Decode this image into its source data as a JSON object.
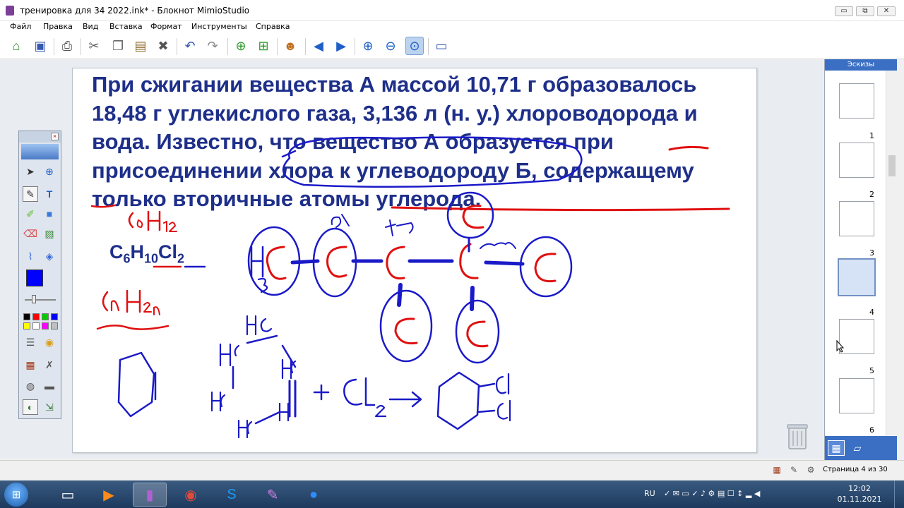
{
  "window": {
    "title": "тренировка для 34 2022.ink* - Блокнот MimioStudio",
    "minimize": "▭",
    "maximize": "⧉",
    "close": "✕"
  },
  "menu": [
    "Файл",
    "Правка",
    "Вид",
    "Вставка",
    "Формат",
    "Инструменты",
    "Справка"
  ],
  "toolbar_icons": [
    "open-icon",
    "save-icon",
    "print-icon",
    "cut-icon",
    "copy-icon",
    "paste-icon",
    "delete-icon",
    "undo-icon",
    "redo-icon",
    "new-page-icon",
    "duplicate-page-icon",
    "users-icon",
    "back-icon",
    "forward-icon",
    "zoom-in-icon",
    "zoom-out-icon",
    "zoom-fit-icon",
    "screen-icon"
  ],
  "task": {
    "text": "При сжигании вещества А массой 10,71 г образовалось 18,48 г углекислого газа, 3,136 л (н. у.) хлороводорода и вода. Известно, что вещество А образуется при присоединении хлора к углеводороду Б, содержащему только вторичные атомы углерода."
  },
  "formula": {
    "c": "C",
    "c_n": "6",
    "h": "H",
    "h_n": "10",
    "cl": "Cl",
    "cl_n": "2"
  },
  "palette": {
    "colors": [
      "#000000",
      "#ff0000",
      "#00cc00",
      "#0000ff",
      "#ffff00",
      "#ffffff",
      "#ff00ff",
      "#c0c0c0"
    ],
    "current_color": "#0000ff"
  },
  "thumbnails": {
    "header": "Эскизы",
    "pages": [
      {
        "num": "1"
      },
      {
        "num": "2"
      },
      {
        "num": "3"
      },
      {
        "num": "4"
      },
      {
        "num": "5"
      },
      {
        "num": "6"
      }
    ],
    "active": "4"
  },
  "status": {
    "page_info": "Страница 4 из 30"
  },
  "taskbar": {
    "lang": "RU",
    "time": "12:02",
    "date": "01.11.2021"
  }
}
